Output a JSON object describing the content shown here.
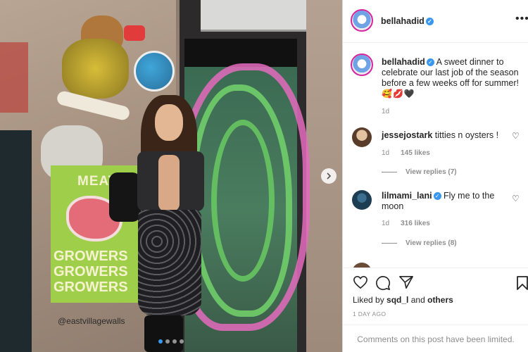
{
  "post": {
    "photo_alt": "Woman posing in front of a graffiti-covered wall and door",
    "carousel": {
      "total": 4,
      "active": 0
    },
    "photo_texts": {
      "poster_meat": "MEAT",
      "poster_growers": "GROWERS GROWERS GROWERS",
      "wall_tag": "@eastvillagewalls"
    }
  },
  "header": {
    "username": "bellahadid",
    "more_icon": "more-horizontal-icon"
  },
  "caption": {
    "username": "bellahadid",
    "text": "A sweet dinner to celebrate our last job of the season before a few weeks off for summer!",
    "emojis": "🥰💋🖤",
    "time": "1d"
  },
  "comments": [
    {
      "username": "jessejostark",
      "text": "titties n oysters !",
      "time": "1d",
      "likes": "145 likes",
      "replies": "View replies (7)",
      "verified": false
    },
    {
      "username": "lilmami_lani",
      "text": "Fly me to the moon",
      "time": "1d",
      "likes": "316 likes",
      "replies": "View replies (8)",
      "verified": true
    }
  ],
  "actions": {
    "liked_by_prefix": "Liked by",
    "liked_by_user": "sqd_l",
    "liked_by_and": "and",
    "liked_by_others": "others",
    "post_age": "1 DAY AGO",
    "comments_limited": "Comments on this post have been limited."
  },
  "colors": {
    "accent": "#3897f0",
    "text": "#262626",
    "muted": "#8e8e8e",
    "border": "#dbdbdb"
  }
}
